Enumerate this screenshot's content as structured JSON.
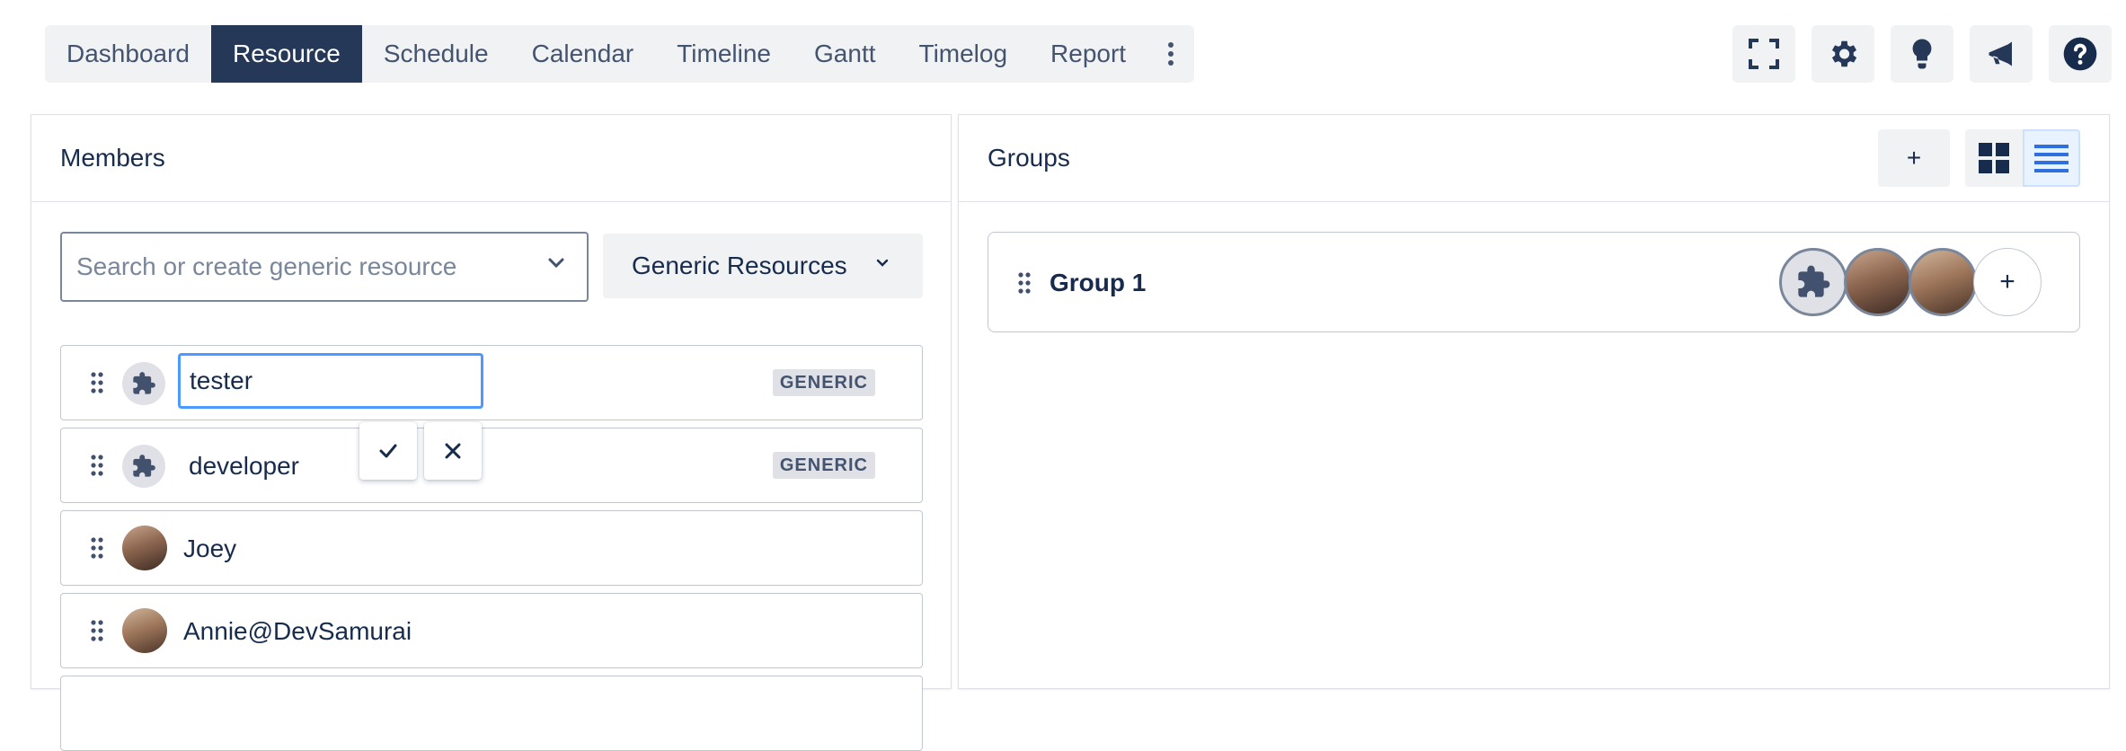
{
  "nav": {
    "tabs": [
      {
        "label": "Dashboard",
        "active": false
      },
      {
        "label": "Resource",
        "active": true
      },
      {
        "label": "Schedule",
        "active": false
      },
      {
        "label": "Calendar",
        "active": false
      },
      {
        "label": "Timeline",
        "active": false
      },
      {
        "label": "Gantt",
        "active": false
      },
      {
        "label": "Timelog",
        "active": false
      },
      {
        "label": "Report",
        "active": false
      }
    ],
    "more_icon": "more-vertical-icon",
    "tools": [
      "fullscreen-icon",
      "gear-icon",
      "lightbulb-icon",
      "megaphone-icon",
      "help-icon"
    ]
  },
  "members": {
    "title": "Members",
    "search": {
      "placeholder": "Search or create generic resource"
    },
    "filter_label": "Generic Resources",
    "editing": {
      "value": "tester",
      "badge": "GENERIC"
    },
    "rows": [
      {
        "name": "developer",
        "badge": "GENERIC",
        "type": "generic"
      },
      {
        "name": "Joey",
        "type": "user"
      },
      {
        "name": "Annie@DevSamurai",
        "type": "user"
      }
    ]
  },
  "groups": {
    "title": "Groups",
    "add_label": "+",
    "items": [
      {
        "name": "Group 1",
        "add_member_label": "+"
      }
    ]
  },
  "colors": {
    "active_tab": "#253858",
    "focus_border": "#4c9aff",
    "list_view_active": "#2f6fde"
  }
}
